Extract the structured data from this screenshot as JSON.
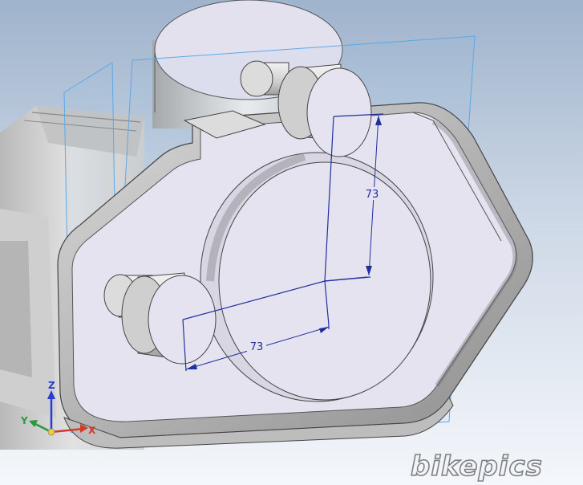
{
  "viewport": {
    "background_top": "#9fb3cc",
    "background_bottom": "#f4f7fb",
    "body_color": "#e8e8e8",
    "plate_face_color": "#e6e3f0",
    "sketch_plane_color": "#5aa9e6",
    "dimension_color": "#1f2fa0"
  },
  "dimensions": {
    "vertical": {
      "value": "73"
    },
    "horizontal": {
      "value": "73"
    }
  },
  "triad": {
    "x_label": "X",
    "y_label": "Y",
    "z_label": "Z",
    "x_color": "#d23a2a",
    "y_color": "#2a9a3a",
    "z_color": "#2a3ad2"
  },
  "watermark": {
    "text": "bikepics"
  }
}
